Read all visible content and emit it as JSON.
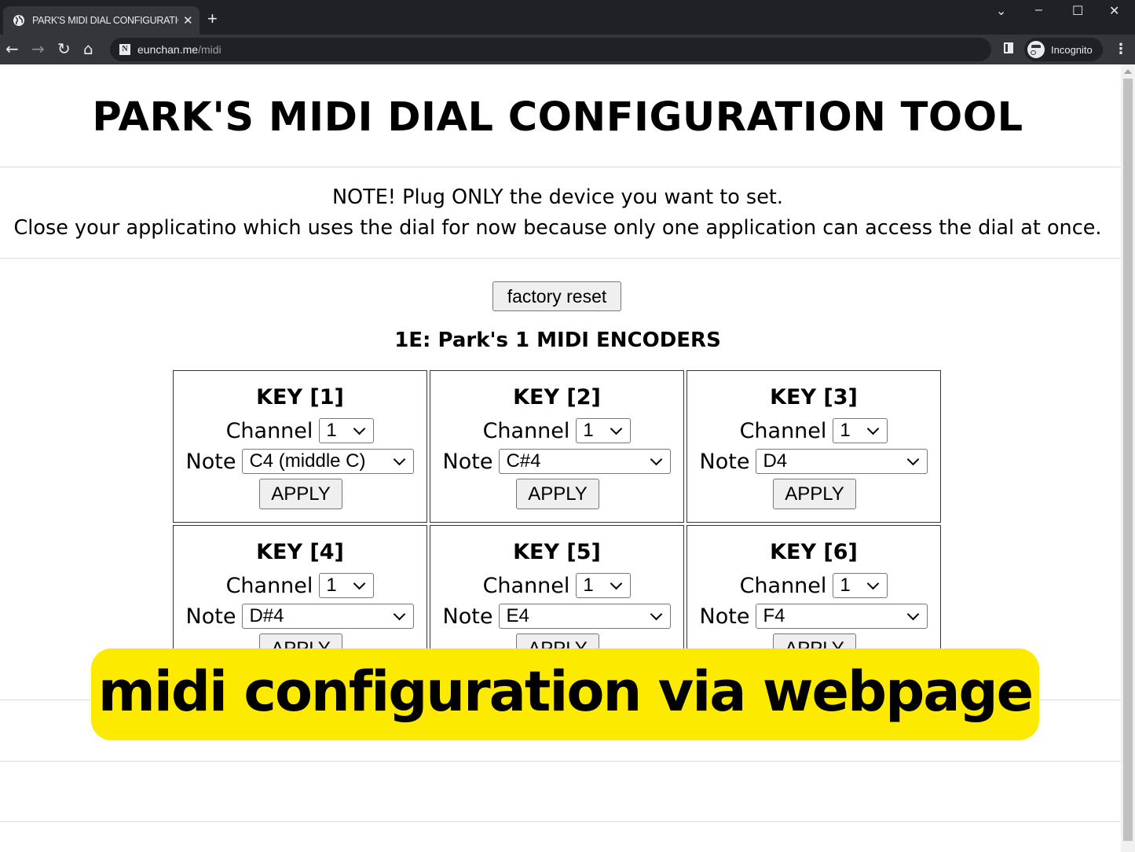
{
  "browser": {
    "tab_title": "PARK'S MIDI DIAL CONFIGURATIC",
    "new_tab_icon": "+",
    "url_host": "eunchan.me",
    "url_path": "/midi",
    "profile_label": "Incognito"
  },
  "page": {
    "title": "PARK'S MIDI DIAL CONFIGURATION TOOL",
    "note_line1": "NOTE! Plug ONLY the device you want to set.",
    "note_line2": "Close your applicatino which uses the dial for now because only one application can access the dial at once.",
    "factory_reset_label": "factory reset",
    "device_title": "1E: Park's 1 MIDI ENCODERS",
    "channel_label": "Channel",
    "note_label": "Note",
    "apply_label": "APPLY",
    "keys": [
      {
        "label": "KEY [1]",
        "channel": "1",
        "note": "C4 (middle C)"
      },
      {
        "label": "KEY [2]",
        "channel": "1",
        "note": "C#4"
      },
      {
        "label": "KEY [3]",
        "channel": "1",
        "note": "D4"
      },
      {
        "label": "KEY [4]",
        "channel": "1",
        "note": "D#4"
      },
      {
        "label": "KEY [5]",
        "channel": "1",
        "note": "E4"
      },
      {
        "label": "KEY [6]",
        "channel": "1",
        "note": "F4"
      }
    ]
  },
  "overlay": {
    "caption": "midi configuration via webpage",
    "color": "#fcea00"
  }
}
